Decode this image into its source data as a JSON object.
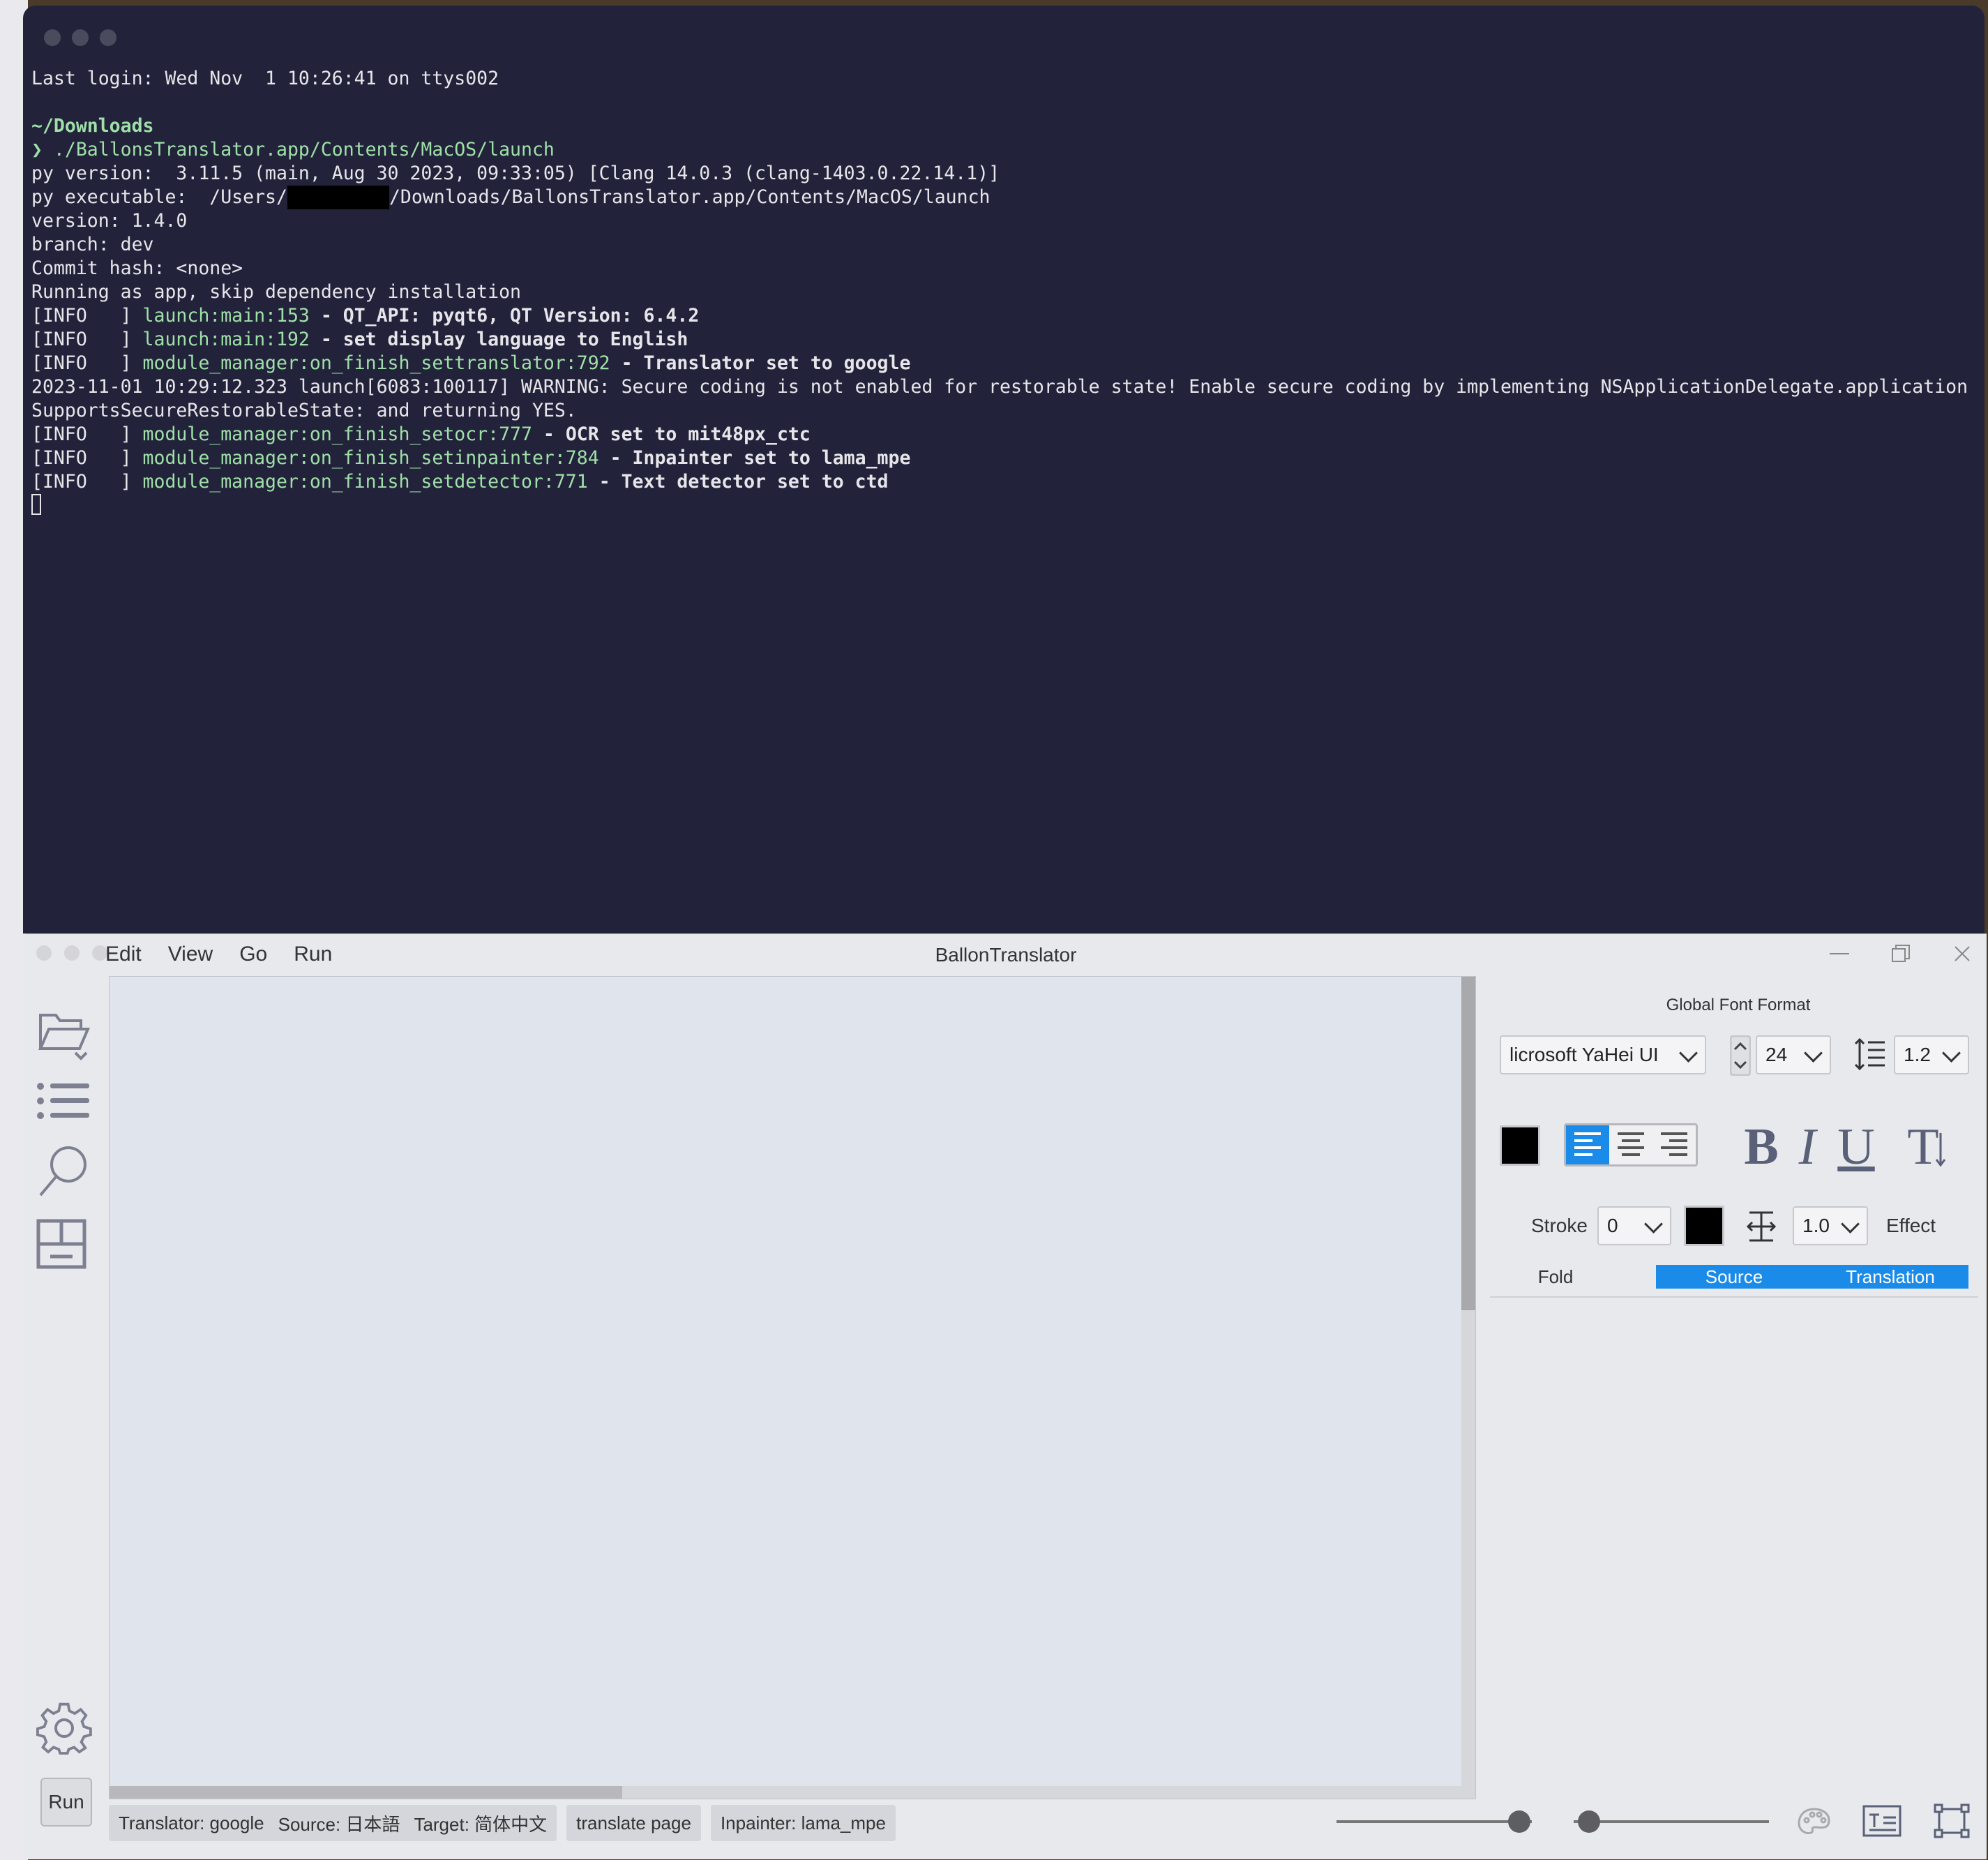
{
  "terminal": {
    "lines": [
      {
        "segments": [
          {
            "text": "Last login: Wed Nov  1 10:26:41 on ttys002",
            "cls": ""
          }
        ]
      },
      {
        "segments": [
          {
            "text": "",
            "cls": ""
          }
        ]
      },
      {
        "segments": [
          {
            "text": "~/Downloads",
            "cls": "green-bold"
          }
        ]
      },
      {
        "segments": [
          {
            "text": "❯ ",
            "cls": "green"
          },
          {
            "text": "./BallonsTranslator.app/Contents/MacOS/launch",
            "cls": "green"
          }
        ]
      },
      {
        "segments": [
          {
            "text": "py version:  3.11.5 (main, Aug 30 2023, 09:33:05) [Clang 14.0.3 (clang-1403.0.22.14.1)]",
            "cls": ""
          }
        ]
      },
      {
        "segments": [
          {
            "text": "py executable:  /Users/",
            "cls": ""
          },
          {
            "text": "",
            "cls": "redact"
          },
          {
            "text": "/Downloads/BallonsTranslator.app/Contents/MacOS/launch",
            "cls": ""
          }
        ]
      },
      {
        "segments": [
          {
            "text": "version: 1.4.0",
            "cls": ""
          }
        ]
      },
      {
        "segments": [
          {
            "text": "branch: dev",
            "cls": ""
          }
        ]
      },
      {
        "segments": [
          {
            "text": "Commit hash: <none>",
            "cls": ""
          }
        ]
      },
      {
        "segments": [
          {
            "text": "Running as app, skip dependency installation",
            "cls": ""
          }
        ]
      },
      {
        "segments": [
          {
            "text": "[INFO   ] ",
            "cls": ""
          },
          {
            "text": "launch:main:153",
            "cls": "green"
          },
          {
            "text": " - QT_API: pyqt6, QT Version: 6.4.2",
            "cls": "bold"
          }
        ]
      },
      {
        "segments": [
          {
            "text": "[INFO   ] ",
            "cls": ""
          },
          {
            "text": "launch:main:192",
            "cls": "green"
          },
          {
            "text": " - set display language to English",
            "cls": "bold"
          }
        ]
      },
      {
        "segments": [
          {
            "text": "[INFO   ] ",
            "cls": ""
          },
          {
            "text": "module_manager:on_finish_settranslator:792",
            "cls": "green"
          },
          {
            "text": " - Translator set to google",
            "cls": "bold"
          }
        ]
      },
      {
        "segments": [
          {
            "text": "2023-11-01 10:29:12.323 launch[6083:100117] WARNING: Secure coding is not enabled for restorable state! Enable secure coding by implementing NSApplicationDelegate.application",
            "cls": ""
          }
        ]
      },
      {
        "segments": [
          {
            "text": "SupportsSecureRestorableState: and returning YES.",
            "cls": ""
          }
        ]
      },
      {
        "segments": [
          {
            "text": "[INFO   ] ",
            "cls": ""
          },
          {
            "text": "module_manager:on_finish_setocr:777",
            "cls": "green"
          },
          {
            "text": " - OCR set to mit48px_ctc",
            "cls": "bold"
          }
        ]
      },
      {
        "segments": [
          {
            "text": "[INFO   ] ",
            "cls": ""
          },
          {
            "text": "module_manager:on_finish_setinpainter:784",
            "cls": "green"
          },
          {
            "text": " - Inpainter set to lama_mpe",
            "cls": "bold"
          }
        ]
      },
      {
        "segments": [
          {
            "text": "[INFO   ] ",
            "cls": ""
          },
          {
            "text": "module_manager:on_finish_setdetector:771",
            "cls": "green"
          },
          {
            "text": " - Text detector set to ctd",
            "cls": "bold"
          }
        ]
      },
      {
        "segments": [
          {
            "text": "",
            "cls": "cursor"
          }
        ]
      }
    ]
  },
  "app": {
    "title": "BallonTranslator",
    "menu": [
      "Edit",
      "View",
      "Go",
      "Run"
    ],
    "run_label": "Run",
    "panel": {
      "title": "Global Font Format",
      "font_family": "Microsoft YaHei UI",
      "font_family_shown": "licrosoft YaHei UI",
      "font_size": "24",
      "line_spacing": "1.2",
      "stroke_label": "Stroke",
      "stroke_value": "0",
      "spacing_value": "1.0",
      "effect_label": "Effect",
      "bold_label": "B",
      "italic_label": "I",
      "underline_label": "U",
      "vertical_label": "T",
      "tabs": [
        "Fold",
        "Source",
        "Translation"
      ]
    },
    "status": {
      "translator": "Translator: google",
      "source": "Source: 日本語",
      "target": "Target: 简体中文",
      "translate_page": "translate page",
      "inpainter": "Inpainter: lama_mpe"
    },
    "colors": {
      "accent": "#1a8be8",
      "font_color": "#000000",
      "stroke_color": "#000000"
    }
  }
}
